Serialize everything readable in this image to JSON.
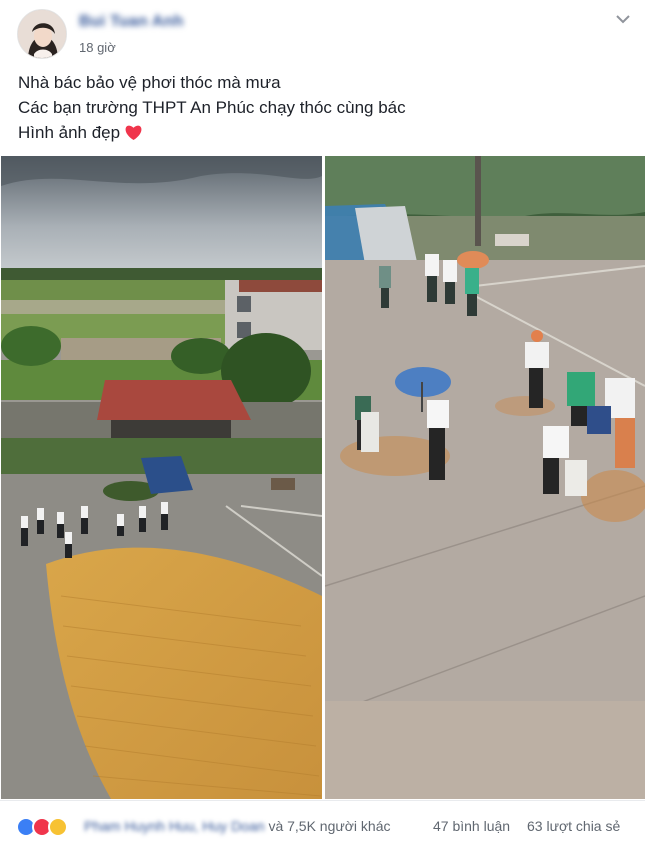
{
  "post": {
    "author": "Bui Tuan Anh",
    "timestamp": "18 giờ",
    "menu_icon": "chevron-down-icon",
    "text_lines": [
      "Nhà bác bảo vệ phơi thóc mà mưa",
      "Các bạn trường THPT An Phúc chạy thóc cùng bác",
      "Hình ảnh đẹp"
    ],
    "emoji": "heart-icon",
    "heart_color": "#f0354c"
  },
  "photos": [
    {
      "name": "rice-drying-yard-wide"
    },
    {
      "name": "students-collecting-rice-closeup"
    }
  ],
  "footer": {
    "reaction_icons": [
      "like-icon",
      "love-icon",
      "haha-icon"
    ],
    "reactor_names": "Pham Huynh Huu, Huy Doan",
    "reactor_suffix": "và 7,5K người khác",
    "comments": "47 bình luận",
    "shares": "63 lượt chia sẻ"
  },
  "colors": {
    "link": "#365899",
    "meta": "#606770",
    "like": "#3b7ff5",
    "love": "#f0354c",
    "haha": "#f7c233"
  }
}
